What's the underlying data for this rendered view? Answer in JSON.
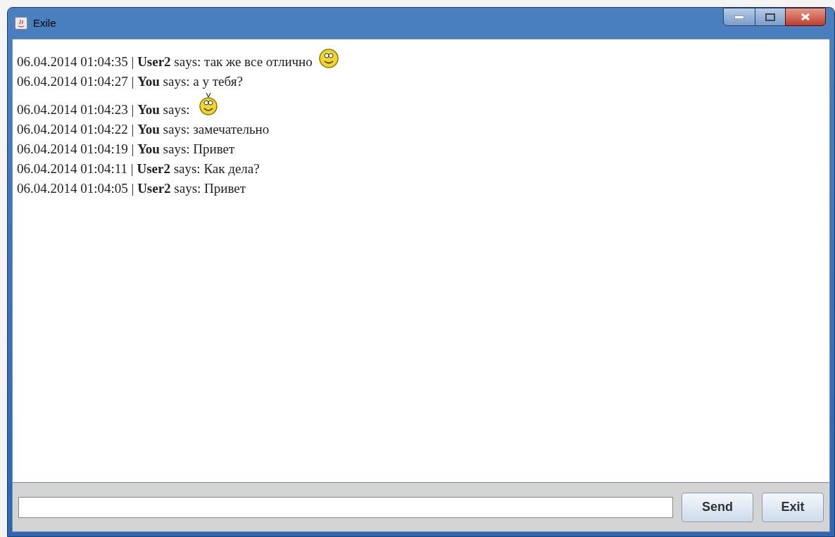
{
  "window": {
    "title": "Exile"
  },
  "messages": [
    {
      "time": "06.04.2014 01:04:35 |",
      "user": "User2",
      "says": "says:",
      "text": "так же все отлично",
      "emoji": {
        "kind": "smile"
      }
    },
    {
      "time": "06.04.2014 01:04:27 |",
      "user": "You",
      "says": "says:",
      "text": "а у тебя?"
    },
    {
      "time": "06.04.2014 01:04:23 |",
      "user": "You",
      "says": "says:",
      "emoji": {
        "kind": "antenna"
      }
    },
    {
      "time": "06.04.2014 01:04:22 |",
      "user": "You",
      "says": "says:",
      "text": "замечательно"
    },
    {
      "time": "06.04.2014 01:04:19 |",
      "user": "You",
      "says": "says:",
      "text": "Привет"
    },
    {
      "time": "06.04.2014 01:04:11 |",
      "user": "User2",
      "says": "says:",
      "text": "Как дела?"
    },
    {
      "time": "06.04.2014 01:04:05 |",
      "user": "User2",
      "says": "says:",
      "text": "Привет"
    }
  ],
  "buttons": [
    "Send",
    "Exit"
  ]
}
